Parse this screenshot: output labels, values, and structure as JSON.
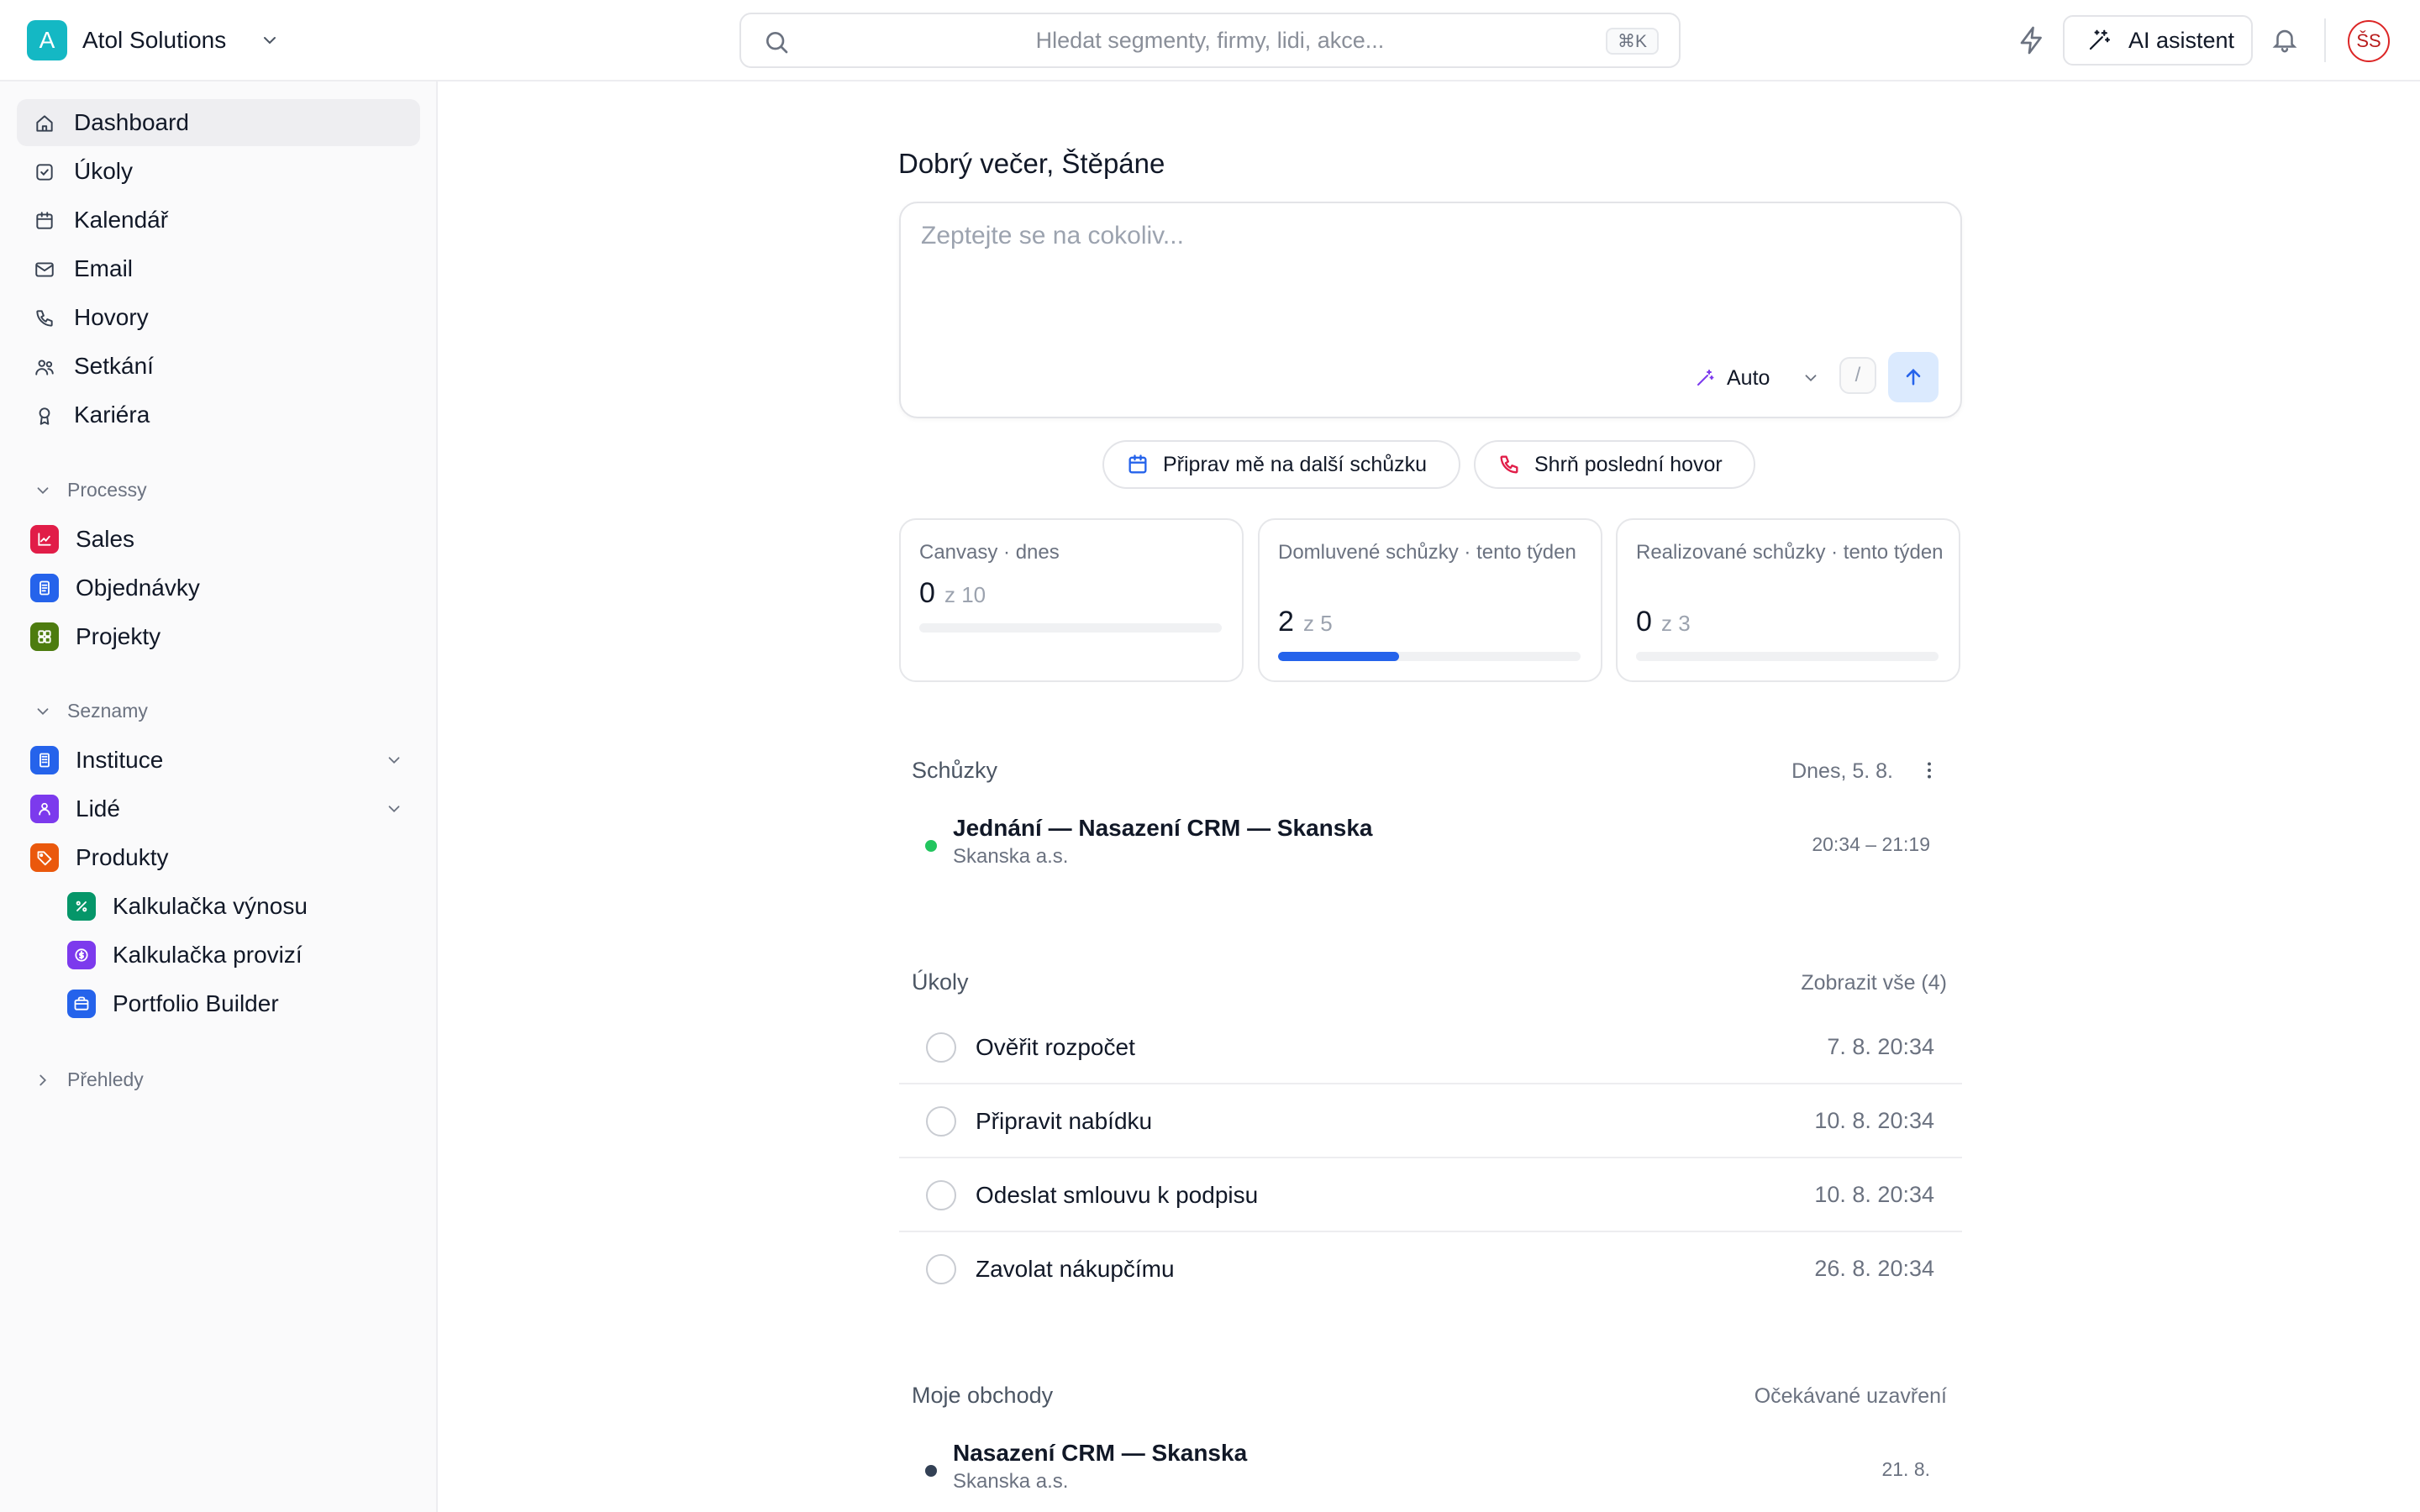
{
  "app": {
    "workspace": "Atol Solutions",
    "workspace_initial": "A",
    "brand_color": "#14b8c4",
    "accent_color": "#2563eb"
  },
  "search": {
    "placeholder": "Hledat segmenty, firmy, lidi, akce...",
    "shortcut": "⌘K"
  },
  "header": {
    "ai_button": "AI asistent",
    "user_initials": "ŠS"
  },
  "sidebar": {
    "nav": [
      {
        "label": "Dashboard",
        "icon": "home-icon",
        "active": true
      },
      {
        "label": "Úkoly",
        "icon": "checkbox-icon"
      },
      {
        "label": "Kalendář",
        "icon": "calendar-icon"
      },
      {
        "label": "Email",
        "icon": "mail-icon"
      },
      {
        "label": "Hovory",
        "icon": "phone-icon"
      },
      {
        "label": "Setkání",
        "icon": "users-icon"
      },
      {
        "label": "Kariéra",
        "icon": "award-icon"
      }
    ],
    "processes": {
      "title": "Processy",
      "items": [
        {
          "label": "Sales",
          "icon": "chart-icon",
          "color": "#e11d48"
        },
        {
          "label": "Objednávky",
          "icon": "document-icon",
          "color": "#2563eb"
        },
        {
          "label": "Projekty",
          "icon": "grid-icon",
          "color": "#4d7c0f"
        }
      ]
    },
    "lists": {
      "title": "Seznamy",
      "items": [
        {
          "label": "Instituce",
          "icon": "building-icon",
          "color": "#2563eb"
        },
        {
          "label": "Lidé",
          "icon": "person-icon",
          "color": "#7c3aed"
        },
        {
          "label": "Produkty",
          "icon": "tag-icon",
          "color": "#ea580c"
        }
      ],
      "sub_items": [
        {
          "label": "Kalkulačka výnosu",
          "icon": "percent-icon",
          "color": "#059669"
        },
        {
          "label": "Kalkulačka provizí",
          "icon": "coin-icon",
          "color": "#7c3aed"
        },
        {
          "label": "Portfolio Builder",
          "icon": "briefcase-icon",
          "color": "#2563eb"
        }
      ]
    },
    "reports": {
      "title": "Přehledy"
    }
  },
  "main": {
    "greeting": "Dobrý večer, Štěpáne",
    "composer": {
      "placeholder": "Zeptejte se na cokoliv...",
      "mode": "Auto",
      "slash": "/"
    },
    "suggestions": [
      {
        "label": "Připrav mě na další schůzku",
        "icon": "calendar-icon"
      },
      {
        "label": "Shrň poslední hovor",
        "icon": "phone-icon"
      }
    ],
    "stats": [
      {
        "title": "Canvasy · dnes",
        "value": "0",
        "of": "z 10",
        "progress": 0
      },
      {
        "title": "Domluvené schůzky · tento týden",
        "value": "2",
        "of": "z 5",
        "progress": 0.4
      },
      {
        "title": "Realizované schůzky · tento týden",
        "value": "0",
        "of": "z 3",
        "progress": 0
      }
    ],
    "meetings": {
      "title": "Schůzky",
      "date": "Dnes, 5. 8.",
      "items": [
        {
          "title": "Jednání — Nasazení CRM — Skanska",
          "company": "Skanska a.s.",
          "time": "20:34 – 21:19",
          "status_color": "#22c55e"
        }
      ]
    },
    "tasks": {
      "title": "Úkoly",
      "show_all": "Zobrazit vše (4)",
      "items": [
        {
          "label": "Ověřit rozpočet",
          "due": "7. 8. 20:34"
        },
        {
          "label": "Připravit nabídku",
          "due": "10. 8. 20:34"
        },
        {
          "label": "Odeslat smlouvu k podpisu",
          "due": "10. 8. 20:34"
        },
        {
          "label": "Zavolat nákupčímu",
          "due": "26. 8. 20:34"
        }
      ]
    },
    "deals": {
      "title": "Moje obchody",
      "column": "Očekávané uzavření",
      "items": [
        {
          "title": "Nasazení CRM — Skanska",
          "company": "Skanska a.s.",
          "date": "21. 8.",
          "status_color": "#334155"
        }
      ]
    }
  }
}
